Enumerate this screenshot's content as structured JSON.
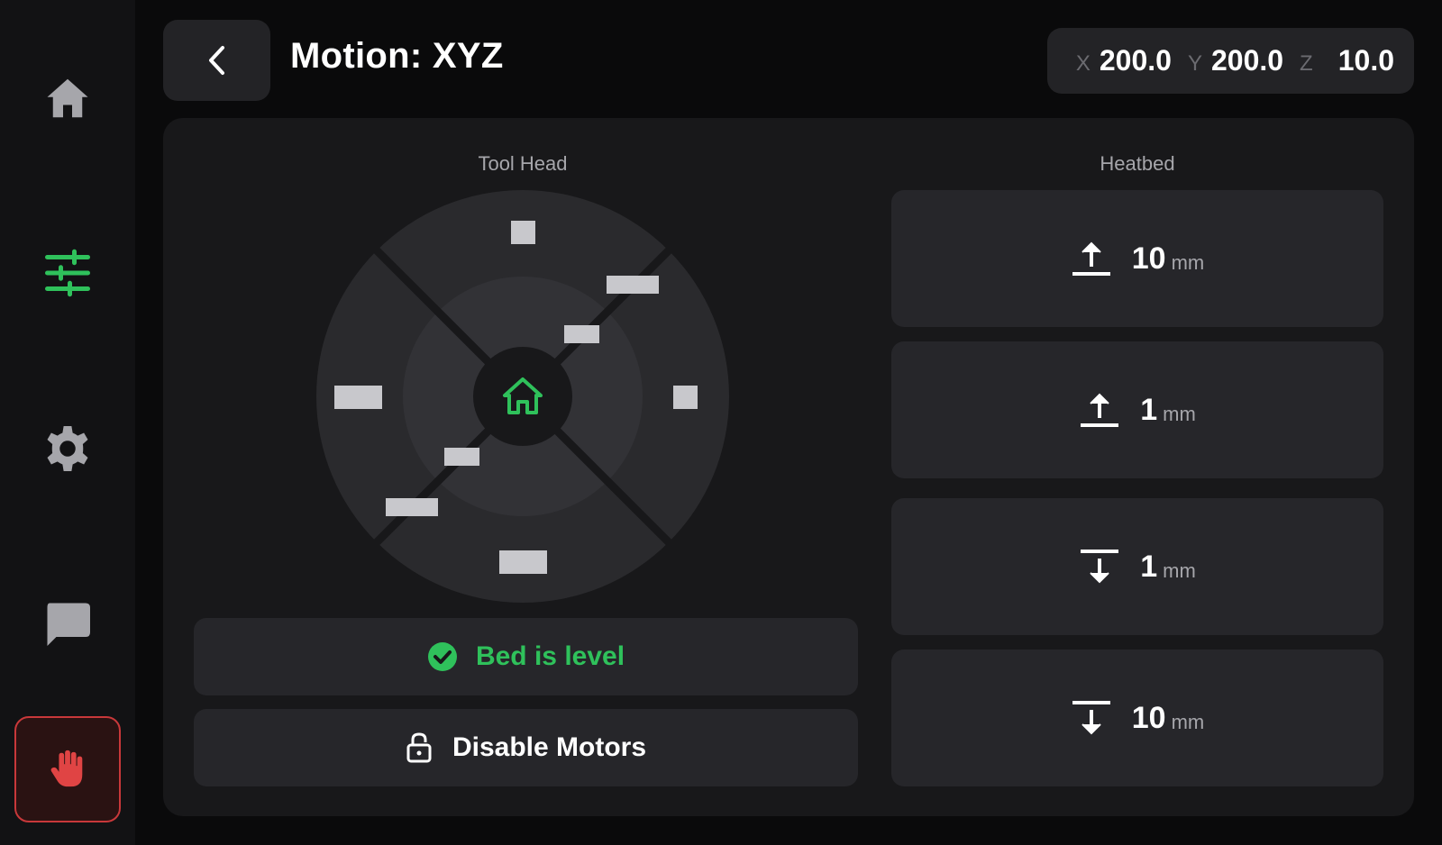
{
  "colors": {
    "accent": "#2fc15b",
    "danger": "#e04444",
    "icon_gray": "#a6a6ab",
    "panel": "#18181a",
    "button": "#26262a"
  },
  "sidebar": {
    "items": [
      {
        "name": "home",
        "icon": "home-icon",
        "active": false
      },
      {
        "name": "controls",
        "icon": "sliders-icon",
        "active": true
      },
      {
        "name": "settings",
        "icon": "gear-icon",
        "active": false
      },
      {
        "name": "messages",
        "icon": "chat-icon",
        "active": false
      },
      {
        "name": "emergency-stop",
        "icon": "hand-stop-icon",
        "active": false
      }
    ]
  },
  "header": {
    "back_icon": "chevron-left-icon",
    "title": "Motion: XYZ",
    "position": {
      "x_label": "X",
      "x_value": "200.0",
      "y_label": "Y",
      "y_value": "200.0",
      "z_label": "Z",
      "z_value": "10.0"
    }
  },
  "toolhead": {
    "label": "Tool Head",
    "home_icon": "home-outline-icon"
  },
  "heatbed": {
    "label": "Heatbed",
    "buttons": [
      {
        "value": "10",
        "unit": "mm",
        "direction": "up",
        "icon": "arrow-up-bar-icon"
      },
      {
        "value": "1",
        "unit": "mm",
        "direction": "up",
        "icon": "arrow-up-bar-icon"
      },
      {
        "value": "1",
        "unit": "mm",
        "direction": "down",
        "icon": "arrow-down-bar-icon"
      },
      {
        "value": "10",
        "unit": "mm",
        "direction": "down",
        "icon": "arrow-down-bar-icon"
      }
    ]
  },
  "status": {
    "bed_level_text": "Bed is level",
    "bed_level_icon": "check-circle-icon"
  },
  "actions": {
    "disable_motors": "Disable Motors",
    "disable_motors_icon": "unlock-icon"
  }
}
